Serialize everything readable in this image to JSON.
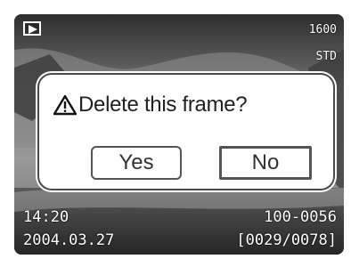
{
  "hud": {
    "iso": "1600",
    "quality": "STD",
    "time": "14:20",
    "date": "2004.03.27",
    "folder_file": "100-0056",
    "frame_counter": "[0029/0078]",
    "playback_icon": "play-icon"
  },
  "dialog": {
    "icon": "warning-icon",
    "prompt": "Delete this frame?",
    "yes_label": "Yes",
    "no_label": "No",
    "selected": "No"
  }
}
